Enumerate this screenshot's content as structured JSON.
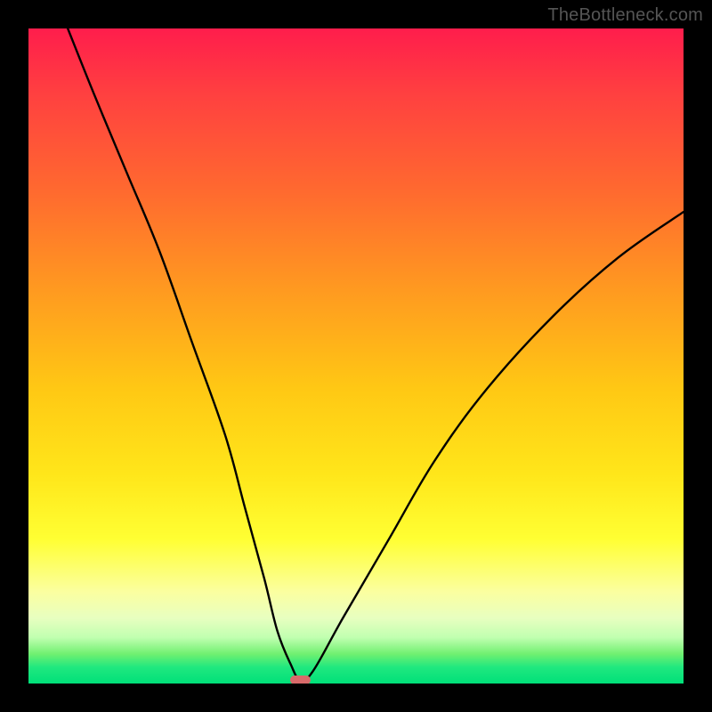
{
  "watermark": "TheBottleneck.com",
  "chart_data": {
    "type": "line",
    "title": "",
    "xlabel": "",
    "ylabel": "",
    "xlim": [
      0,
      100
    ],
    "ylim": [
      0,
      100
    ],
    "grid": false,
    "legend": false,
    "annotations": [],
    "gradient_stops": [
      {
        "pos": 0,
        "color": "#ff1d4c"
      },
      {
        "pos": 10,
        "color": "#ff4040"
      },
      {
        "pos": 25,
        "color": "#ff6a2f"
      },
      {
        "pos": 40,
        "color": "#ff9a20"
      },
      {
        "pos": 55,
        "color": "#ffc814"
      },
      {
        "pos": 68,
        "color": "#ffe61a"
      },
      {
        "pos": 78,
        "color": "#ffff33"
      },
      {
        "pos": 86,
        "color": "#fbffa0"
      },
      {
        "pos": 90,
        "color": "#e8ffc0"
      },
      {
        "pos": 93,
        "color": "#c0ffb0"
      },
      {
        "pos": 95.5,
        "color": "#70f070"
      },
      {
        "pos": 97.5,
        "color": "#20e87f"
      },
      {
        "pos": 100,
        "color": "#00e079"
      }
    ],
    "series": [
      {
        "name": "bottleneck-curve",
        "color": "#000000",
        "x": [
          6,
          10,
          15,
          20,
          25,
          30,
          33,
          36,
          38,
          40,
          41.5,
          43.5,
          48,
          55,
          62,
          70,
          80,
          90,
          100
        ],
        "y": [
          100,
          90,
          78,
          66,
          52,
          38,
          27,
          16,
          8,
          3,
          0.5,
          2,
          10,
          22,
          34,
          45,
          56,
          65,
          72
        ]
      }
    ],
    "marker": {
      "x": 41.5,
      "y": 0.5,
      "width_pct": 3.2,
      "height_pct": 1.4,
      "color": "#d86a6a"
    }
  }
}
